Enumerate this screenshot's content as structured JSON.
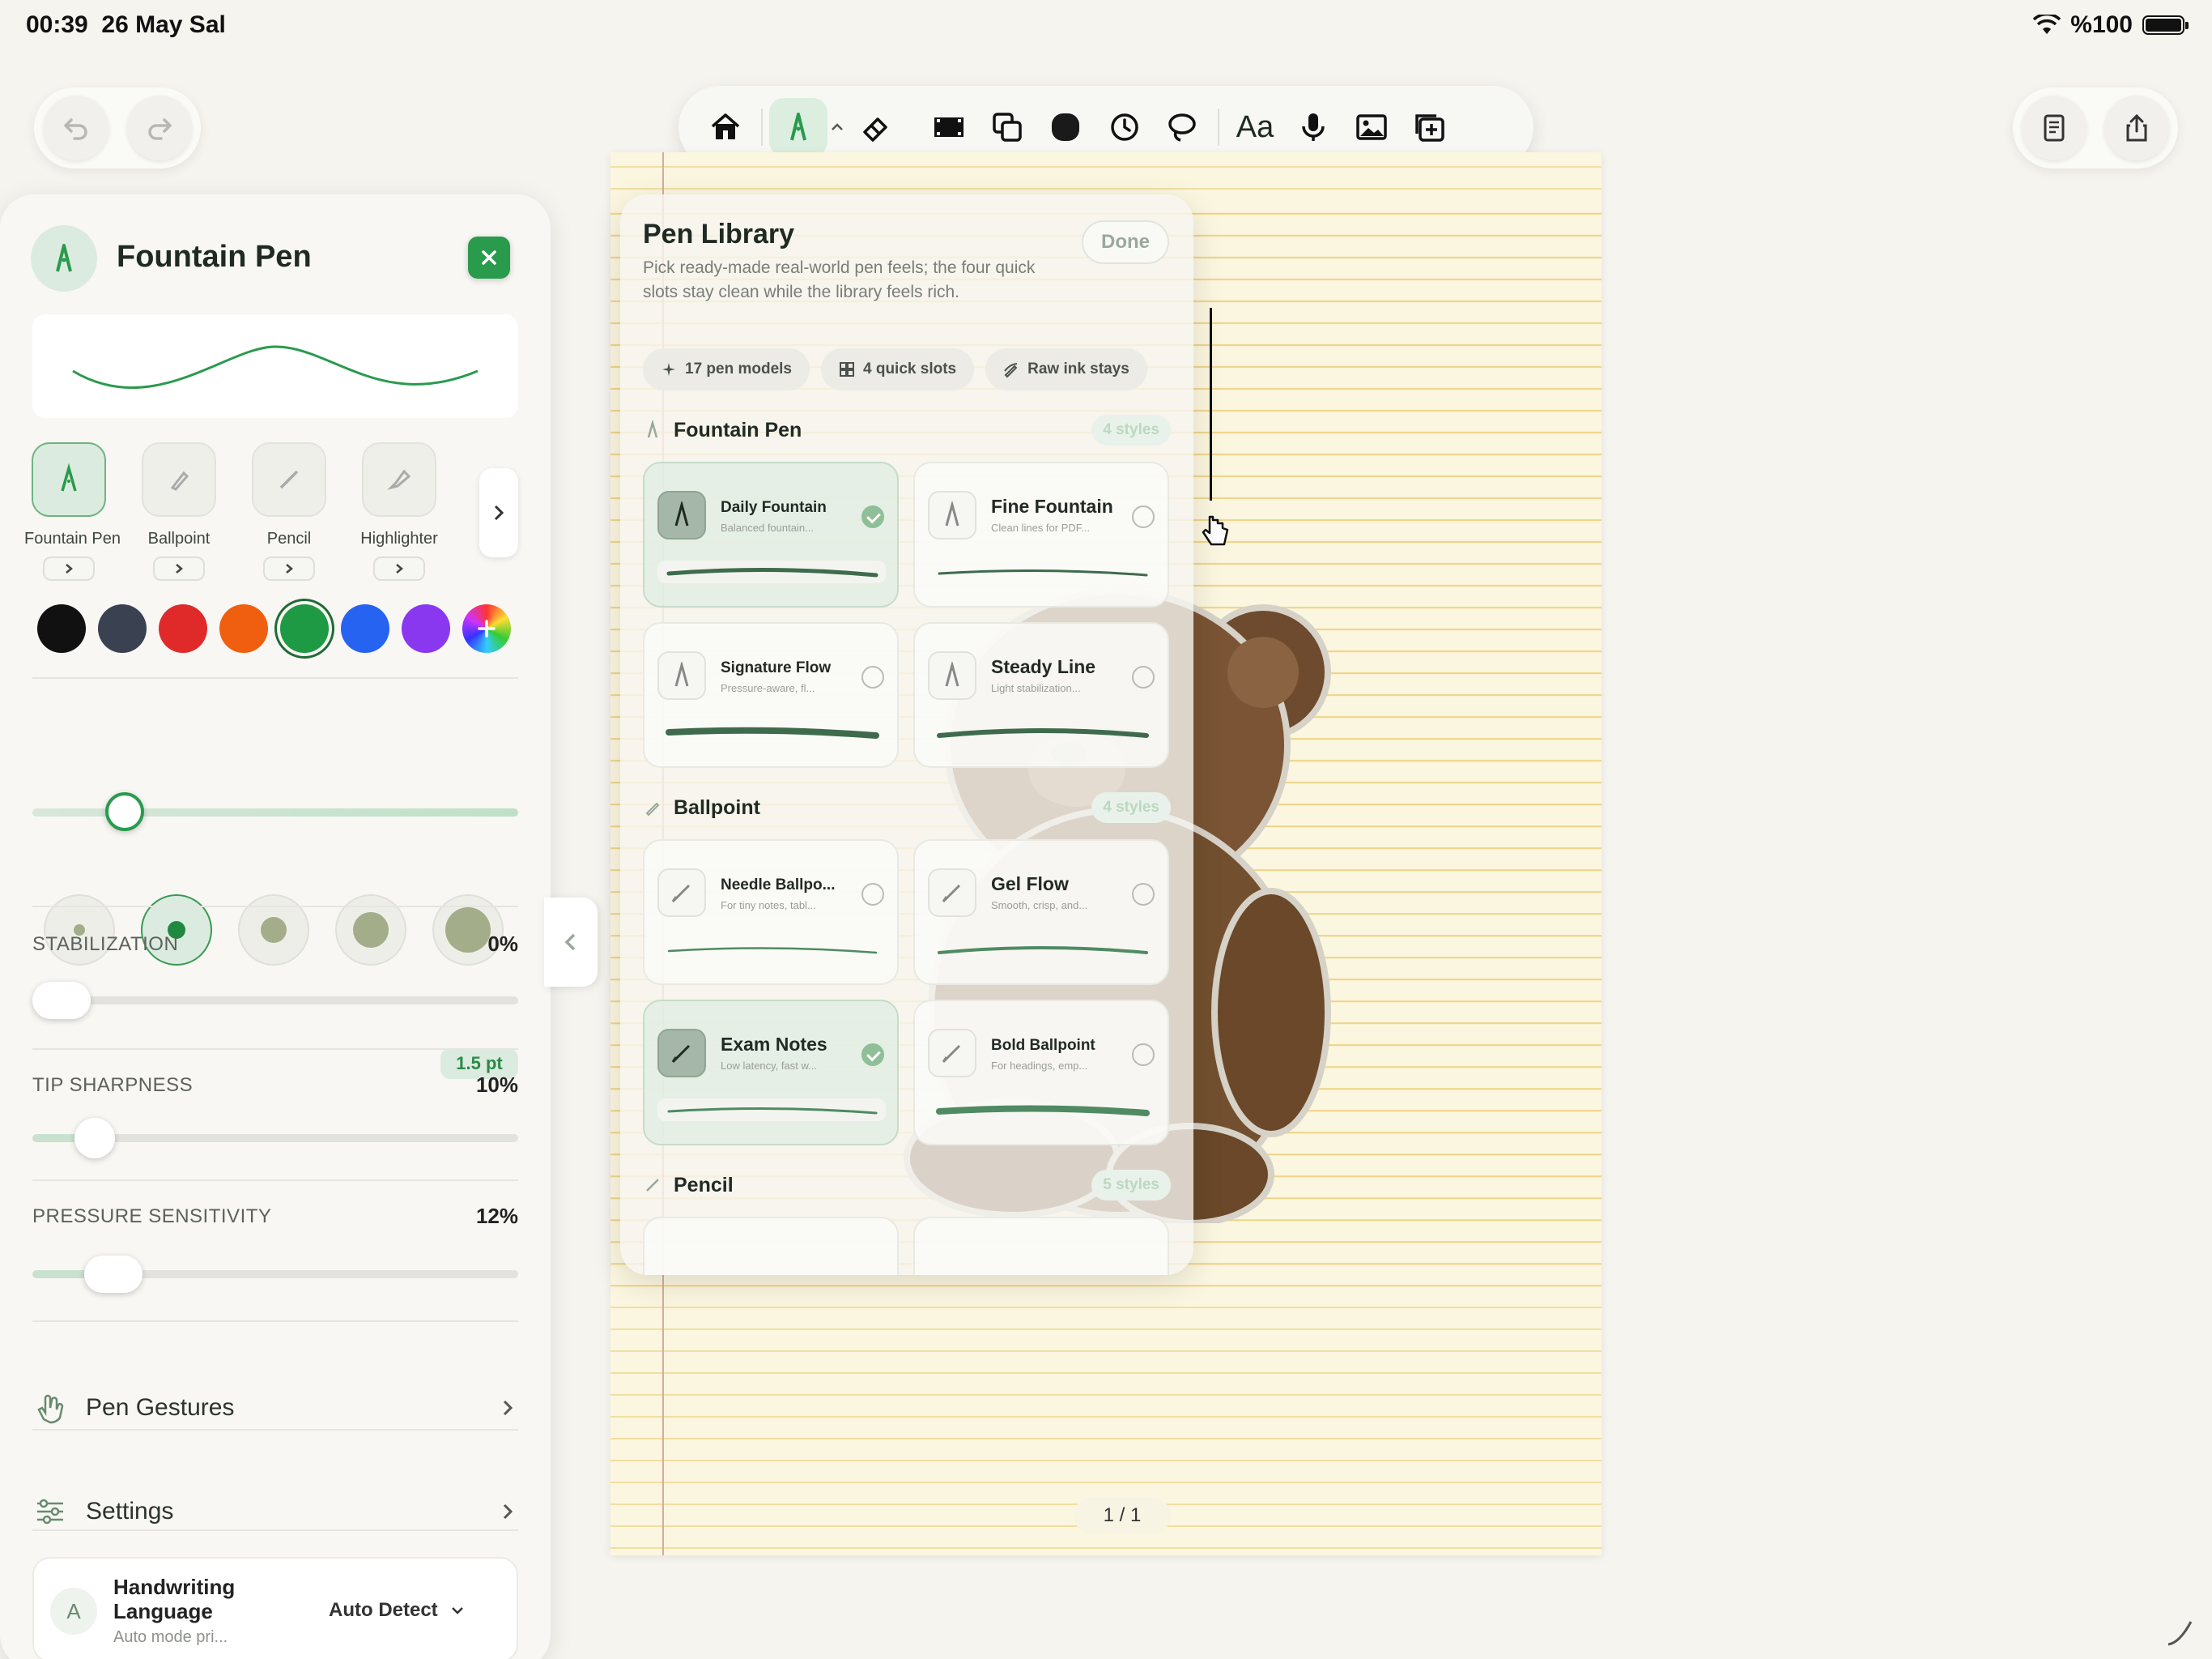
{
  "status_bar": {
    "time": "00:39",
    "date": "26 May Sal",
    "battery": "%100"
  },
  "toolbar": {
    "icons": [
      "home-icon",
      "fountain-pen-icon",
      "eraser-icon",
      "film-strip-icon",
      "shapes-icon",
      "ink-blob-icon",
      "history-icon",
      "lasso-icon",
      "text-icon",
      "microphone-icon",
      "image-icon",
      "add-page-icon"
    ],
    "text_tool_label": "Aa"
  },
  "page": {
    "counter": "1 / 1"
  },
  "pen_library": {
    "title": "Pen Library",
    "done_label": "Done",
    "description": "Pick ready-made real-world pen feels; the four quick slots stay clean while the library feels rich.",
    "chips": [
      "17 pen models",
      "4 quick slots",
      "Raw ink stays"
    ],
    "sections": [
      {
        "title": "Fountain Pen",
        "badge": "4 styles"
      },
      {
        "title": "Ballpoint",
        "badge": "4 styles"
      },
      {
        "title": "Pencil",
        "badge": "5 styles"
      }
    ],
    "cards": [
      {
        "name": "Daily Fountain",
        "sub": "Balanced fountain...",
        "selected": true
      },
      {
        "name": "Fine Fountain",
        "sub": "Clean lines for PDF...",
        "selected": false
      },
      {
        "name": "Signature Flow",
        "sub": "Pressure-aware, fl...",
        "selected": false
      },
      {
        "name": "Steady Line",
        "sub": "Light stabilization...",
        "selected": false
      },
      {
        "name": "Needle Ballpo...",
        "sub": "For tiny notes, tabl...",
        "selected": false
      },
      {
        "name": "Gel Flow",
        "sub": "Smooth, crisp, and...",
        "selected": false
      },
      {
        "name": "Exam Notes",
        "sub": "Low latency, fast w...",
        "selected": true
      },
      {
        "name": "Bold Ballpoint",
        "sub": "For headings, emp...",
        "selected": false
      }
    ]
  },
  "pen_panel": {
    "title": "Fountain Pen",
    "pen_types": [
      "Fountain Pen",
      "Ballpoint",
      "Pencil",
      "Highlighter"
    ],
    "selected_pen_type": "Fountain Pen",
    "colors": [
      "#111111",
      "#3a4150",
      "#e02a2a",
      "#f05f10",
      "#1e9a44",
      "#2563f0",
      "#8a38f0"
    ],
    "selected_color": "#1e9a44",
    "size_value": "1.5 pt",
    "stabilization": {
      "label": "STABILIZATION",
      "value": "0%"
    },
    "tip_sharpness": {
      "label": "TIP SHARPNESS",
      "value": "10%"
    },
    "pressure_sensitivity": {
      "label": "PRESSURE SENSITIVITY",
      "value": "12%"
    },
    "pen_gestures": "Pen Gestures",
    "settings": "Settings",
    "handwriting": {
      "title": "Handwriting Language",
      "sub": "Auto mode pri...",
      "value": "Auto Detect"
    }
  },
  "accent": "#2a9a4d"
}
